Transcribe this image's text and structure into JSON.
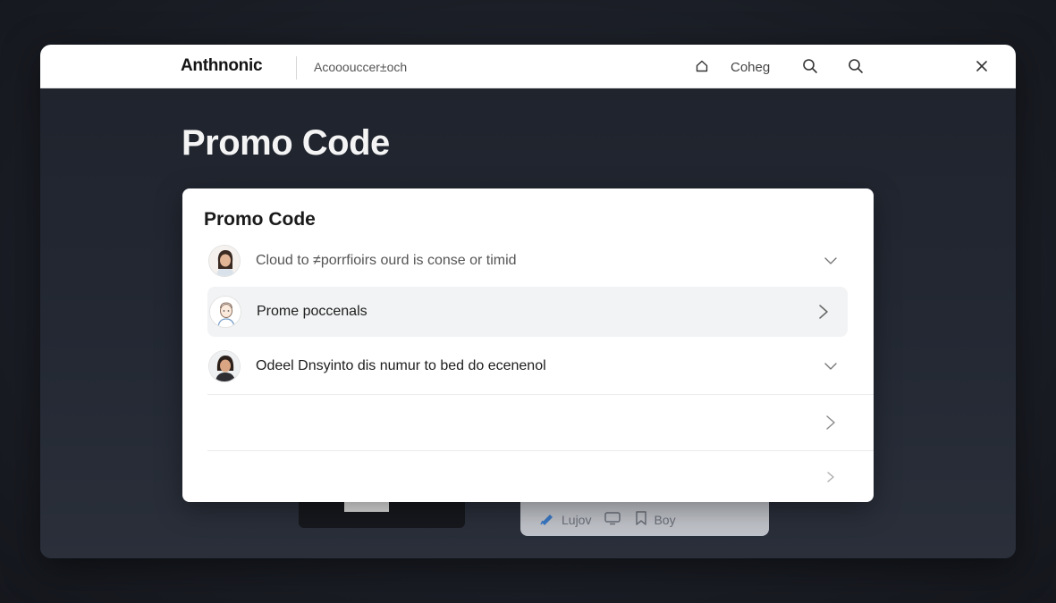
{
  "topbar": {
    "brand": "Anthnonic",
    "breadcrumb": "Acooouccer±och",
    "link_label": "Coheg",
    "icons": [
      "home-icon",
      "search-icon",
      "search-icon",
      "close-icon"
    ]
  },
  "page": {
    "title": "Promo Code"
  },
  "card": {
    "title": "Promo Code",
    "rows": [
      {
        "label": "Cloud to ≠porrfioirs ourd is conse or timid",
        "chevron": "chevron-down-icon"
      },
      {
        "label": "Prome poccenals",
        "chevron": "chevron-right-icon"
      },
      {
        "label": "Odeel Dnsyinto dis numur to bed do ecenenol",
        "chevron": "chevron-down-icon"
      },
      {
        "label": "",
        "chevron": "chevron-right-icon"
      },
      {
        "label": "",
        "chevron": "chevron-right-icon"
      }
    ]
  },
  "bottom_toolbar": {
    "items": [
      {
        "label": "Lujov",
        "icon": "pen-icon"
      },
      {
        "label": "",
        "icon": "monitor-icon"
      },
      {
        "label": "Boy",
        "icon": "bookmark-icon"
      }
    ]
  },
  "colors": {
    "background": "#1a1d24",
    "card": "#ffffff",
    "highlight_row": "#f2f3f4",
    "accent_pen": "#3a78c4"
  }
}
